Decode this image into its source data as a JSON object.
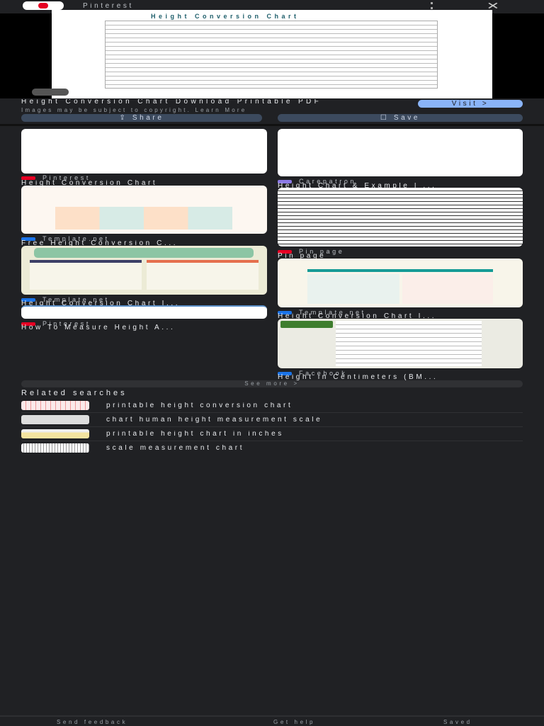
{
  "topbar": {
    "source": "Pinterest",
    "menu_icon": "more-vert",
    "close_icon": "close"
  },
  "preview": {
    "image_title": "Height Conversion Chart",
    "title": "Height Conversion Chart Download Printable PDF",
    "notice": "Images may be subject to copyright. Learn More",
    "visit": "Visit  >",
    "share": "Share",
    "save": "Save"
  },
  "results": {
    "left": [
      {
        "source": "Pinterest",
        "title": "Height Conversion Chart",
        "badge": "#e60023"
      },
      {
        "source": "Template.net",
        "title": "Free Height Conversion C...",
        "badge": "#1a73e8"
      },
      {
        "source": "Template.net",
        "title": "Height Conversion Chart I...",
        "badge": "#1a73e8"
      },
      {
        "source": "Pinterest",
        "title": "How To Measure Height A...",
        "badge": "#e60023"
      }
    ],
    "right": [
      {
        "source": "Carepatron",
        "title": "Height Chart & Example | ...",
        "badge": "#8c7ae6"
      },
      {
        "source": "Pin page",
        "title": "Pin page",
        "badge": "#e60023"
      },
      {
        "source": "Template.net",
        "title": "Height Conversion Chart I...",
        "badge": "#1a73e8"
      },
      {
        "source": "Facebook",
        "title": "Height in Centimeters (BM...",
        "badge": "#1a73e8"
      }
    ]
  },
  "see_more": "See more   >",
  "related": {
    "heading": "Related searches",
    "items": [
      "printable height conversion chart",
      "chart human height measurement scale",
      "printable height chart in inches",
      "scale measurement chart"
    ]
  },
  "footer": {
    "feedback": "Send feedback",
    "help": "Get help",
    "saved": "Saved"
  }
}
